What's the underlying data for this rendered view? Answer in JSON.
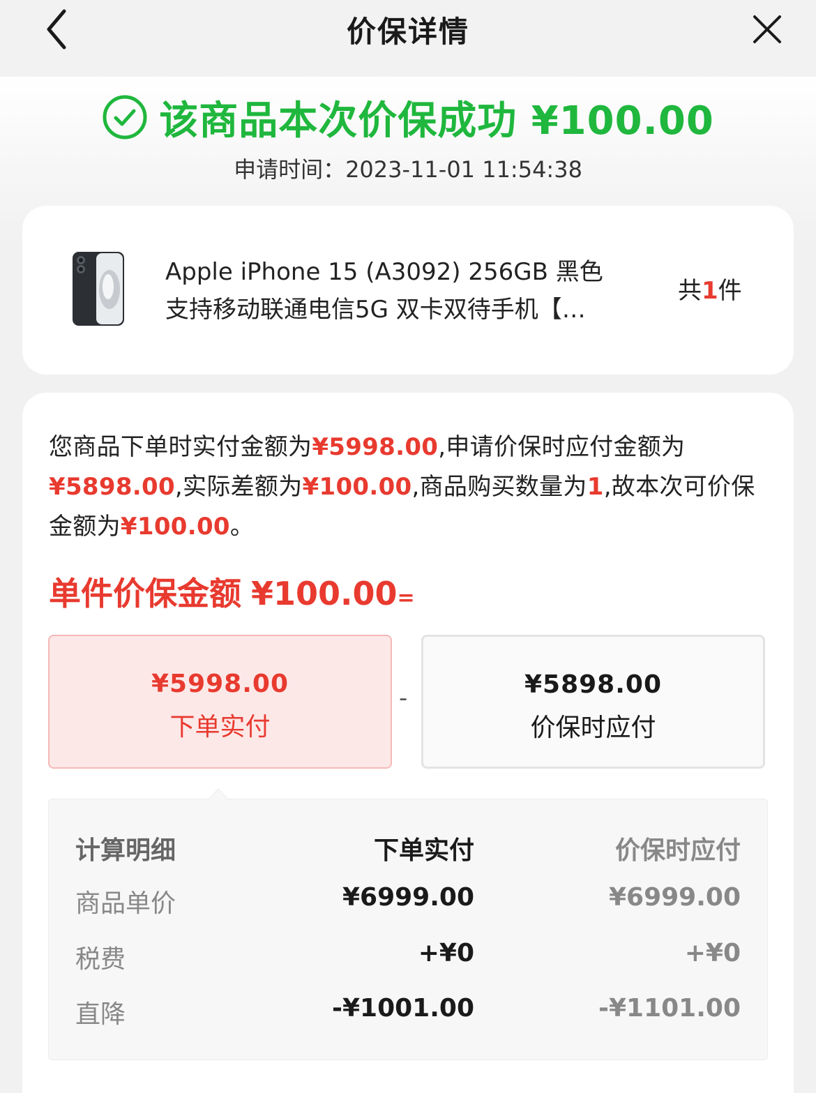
{
  "nav": {
    "title": "价保详情",
    "back_icon": "chevron-left-icon",
    "close_icon": "close-icon"
  },
  "status": {
    "icon": "check-circle-icon",
    "message": "该商品本次价保成功 ¥100.00",
    "apply_time": "申请时间：2023-11-01 11:54:38"
  },
  "product": {
    "name_line1": "Apple iPhone 15 (A3092) 256GB 黑色",
    "name_line2": "支持移动联通电信5G 双卡双待手机【…",
    "qty_prefix": "共",
    "qty": "1",
    "qty_suffix": "件"
  },
  "summary": {
    "p1": "您商品下单时实付金额为",
    "order_paid": "¥5998.00",
    "p2": ",申请价保时应付金额为",
    "protect_pay": "¥5898.00",
    "p3": ",实际差额为",
    "diff": "¥100.00",
    "p4": ",商品购买数量为",
    "qty": "1",
    "p5": ",故本次可价保金额为",
    "refund": "¥100.00",
    "p6": "。"
  },
  "unit": {
    "title": "单件价保金额",
    "amount": "¥100.00",
    "equals": "="
  },
  "compare": {
    "left_value": "¥5998.00",
    "left_label": "下单实付",
    "operator": "-",
    "right_value": "¥5898.00",
    "right_label": "价保时应付"
  },
  "breakdown": {
    "header": [
      "计算明细",
      "下单实付",
      "价保时应付"
    ],
    "rows": [
      {
        "label": "商品单价",
        "order": "¥6999.00",
        "protect": "¥6999.00"
      },
      {
        "label": "税费",
        "order": "+¥0",
        "protect": "+¥0"
      },
      {
        "label": "直降",
        "order": "-¥1001.00",
        "protect": "-¥1101.00"
      }
    ]
  },
  "colors": {
    "success": "#1fb73d",
    "accent_red": "#e83a2f",
    "left_box_bg": "#fde8e8"
  }
}
